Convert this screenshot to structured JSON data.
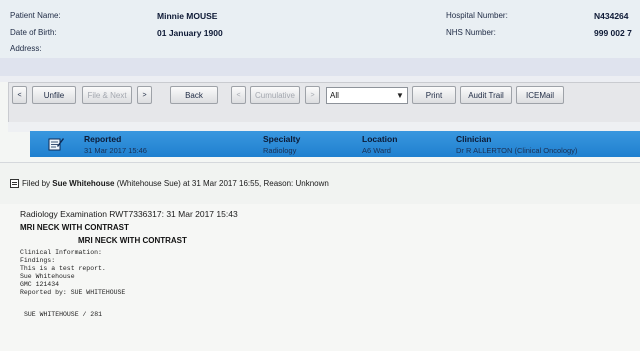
{
  "patient": {
    "name_label": "Patient Name:",
    "name_value": "Minnie MOUSE",
    "dob_label": "Date of Birth:",
    "dob_value": "01 January 1900",
    "address_label": "Address:",
    "hospital_label": "Hospital Number:",
    "hospital_value": "N434264",
    "nhs_label": "NHS Number:",
    "nhs_value": "999 002 7"
  },
  "toolbar": {
    "prev_arrow": "<",
    "unfile_label": "Unfile",
    "file_next_label": "File & Next",
    "next_arrow": ">",
    "back_label": "Back",
    "cum_prev_arrow": "<",
    "cumulative_label": "Cumulative",
    "cum_next_arrow": ">",
    "filter_value": "All",
    "print_label": "Print",
    "audit_label": "Audit Trail",
    "icemail_label": "ICEMail"
  },
  "status_row": {
    "reported_head": "Reported",
    "reported_value": "31 Mar 2017 15:46",
    "specialty_head": "Specialty",
    "specialty_value": "Radiology",
    "location_head": "Location",
    "location_value": "A6 Ward",
    "clinician_head": "Clinician",
    "clinician_value": "Dr R ALLERTON (Clinical Oncology)"
  },
  "filed": {
    "prefix": "Filed by",
    "name": "Sue Whitehouse",
    "suffix": "(Whitehouse Sue) at 31 Mar 2017 16:55, Reason: Unknown"
  },
  "report": {
    "exam_line": "Radiology Examination RWT7336317: 31 Mar 2017 15:43",
    "title1": "MRI NECK WITH CONTRAST",
    "title2": "MRI NECK WITH CONTRAST",
    "lines": [
      "Clinical Information:",
      "Findings:",
      "This is a test report.",
      "Sue Whitehouse",
      "GMC 121434",
      "Reported by: SUE WHITEHOUSE"
    ],
    "signature": "SUE WHITEHOUSE / 281"
  },
  "colors": {
    "accent_row": "#2a8cd8",
    "header_bg": "#e9eff3"
  }
}
